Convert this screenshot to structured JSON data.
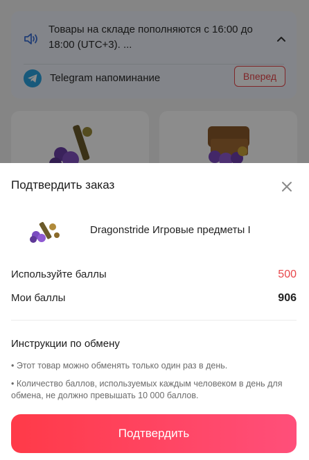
{
  "background": {
    "notice": {
      "text": "Товары на складе пополняются с 16:00 до 18:00 (UTC+3). ...",
      "icon": "speaker-icon",
      "toggle_icon": "chevron-up-icon"
    },
    "telegram": {
      "label": "Telegram напоминание",
      "button_label": "Вперед",
      "icon": "telegram-icon"
    }
  },
  "sheet": {
    "title": "Подтвердить заказ",
    "close_icon": "close-icon",
    "product": {
      "name": "Dragonstride Игровые предметы I"
    },
    "points": [
      {
        "label": "Используйте баллы",
        "value": "500",
        "color": "#e8464a"
      },
      {
        "label": "Мои баллы",
        "value": "906",
        "color": "#222222"
      }
    ],
    "instructions": {
      "title": "Инструкции по обмену",
      "items": [
        "• Этот товар можно обменять только один раз в день.",
        "• Количество баллов, используемых каждым человеком в день для обмена, не должно превышать 10 000 баллов."
      ]
    },
    "confirm_label": "Подтвердить"
  },
  "colors": {
    "accent": "#e8464a",
    "button_gradient_start": "#ff3a48",
    "button_gradient_end": "#ff4f7a",
    "overlay": "rgba(0,0,0,0.45)"
  }
}
